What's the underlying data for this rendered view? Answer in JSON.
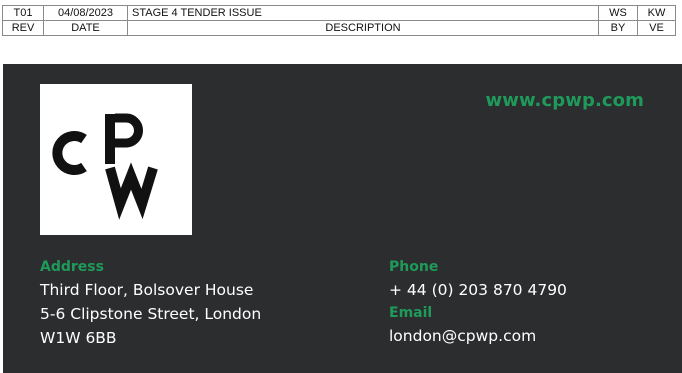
{
  "revision_table": {
    "rows": [
      {
        "rev": "T01",
        "date": "04/08/2023",
        "description": "STAGE 4 TENDER ISSUE",
        "by": "WS",
        "ve": "KW"
      }
    ],
    "headers": {
      "rev": "REV",
      "date": "DATE",
      "description": "DESCRIPTION",
      "by": "BY",
      "ve": "VE"
    }
  },
  "company": {
    "logo_text": "CPW",
    "website": "www.cpwp.com",
    "address": {
      "label": "Address",
      "lines": [
        "Third Floor, Bolsover House",
        "5-6 Clipstone Street, London",
        "W1W 6BB"
      ]
    },
    "phone": {
      "label": "Phone",
      "value": "+ 44 (0) 203 870 4790"
    },
    "email": {
      "label": "Email",
      "value": "london@cpwp.com"
    }
  },
  "colors": {
    "panel_bg": "#2b2d2f",
    "accent_green": "#1f9a5a",
    "text_white": "#ffffff"
  }
}
